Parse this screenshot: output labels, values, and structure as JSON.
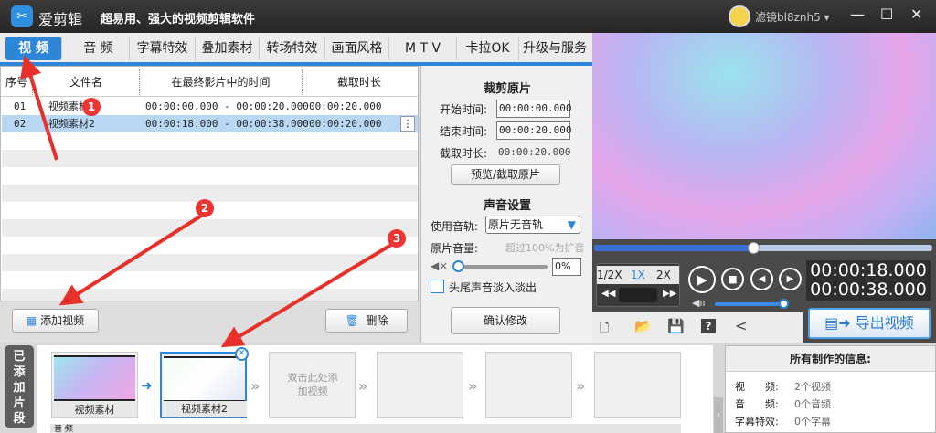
{
  "titlebar": {
    "app_name": "爱剪辑",
    "slogan": "超易用、强大的视频剪辑软件",
    "username": "滤镜bl8znh5"
  },
  "tabs": [
    "视 频",
    "音 频",
    "字幕特效",
    "叠加素材",
    "转场特效",
    "画面风格",
    "M T V",
    "卡拉OK",
    "升级与服务"
  ],
  "table": {
    "headers": [
      "序号",
      "文件名",
      "在最终影片中的时间",
      "截取时长"
    ],
    "rows": [
      {
        "no": "01",
        "name": "视频素材",
        "range": "00:00:00.000 - 00:00:20.000",
        "duration": "00:00:20.000"
      },
      {
        "no": "02",
        "name": "视频素材2",
        "range": "00:00:18.000 - 00:00:38.000",
        "duration": "00:00:20.000"
      }
    ]
  },
  "list_buttons": {
    "add": "添加视频",
    "delete": "删除"
  },
  "trim": {
    "title": "裁剪原片",
    "start_label": "开始时间:",
    "start": "00:00:00.000",
    "end_label": "结束时间:",
    "end": "00:00:20.000",
    "dur_label": "截取时长:",
    "dur": "00:00:20.000",
    "preview_btn": "预览/截取原片"
  },
  "audio": {
    "title": "声音设置",
    "track_label": "使用音轨:",
    "track": "原片无音轨",
    "vol_label": "原片音量:",
    "vol_hint": "超过100%为扩音",
    "vol": "0%",
    "fade": "头尾声音淡入淡出",
    "confirm": "确认修改"
  },
  "player": {
    "progress": 0.47,
    "speeds": [
      "1/2X",
      "1X",
      "2X"
    ],
    "current": "00:00:18.000",
    "total": "00:00:38.000",
    "export": "导出视频"
  },
  "clips": {
    "tab": "已添加片段",
    "items": [
      "视频素材",
      "视频素材2"
    ],
    "placeholder": "双击此处添加视频",
    "audio_label": "音 频"
  },
  "info": {
    "title": "所有制作的信息:",
    "rows": [
      {
        "k": "视　　频:",
        "v": "2个视频"
      },
      {
        "k": "音　　频:",
        "v": "0个音频"
      },
      {
        "k": "字幕特效:",
        "v": "0个字幕"
      }
    ]
  },
  "annotations": [
    "1",
    "2",
    "3"
  ]
}
